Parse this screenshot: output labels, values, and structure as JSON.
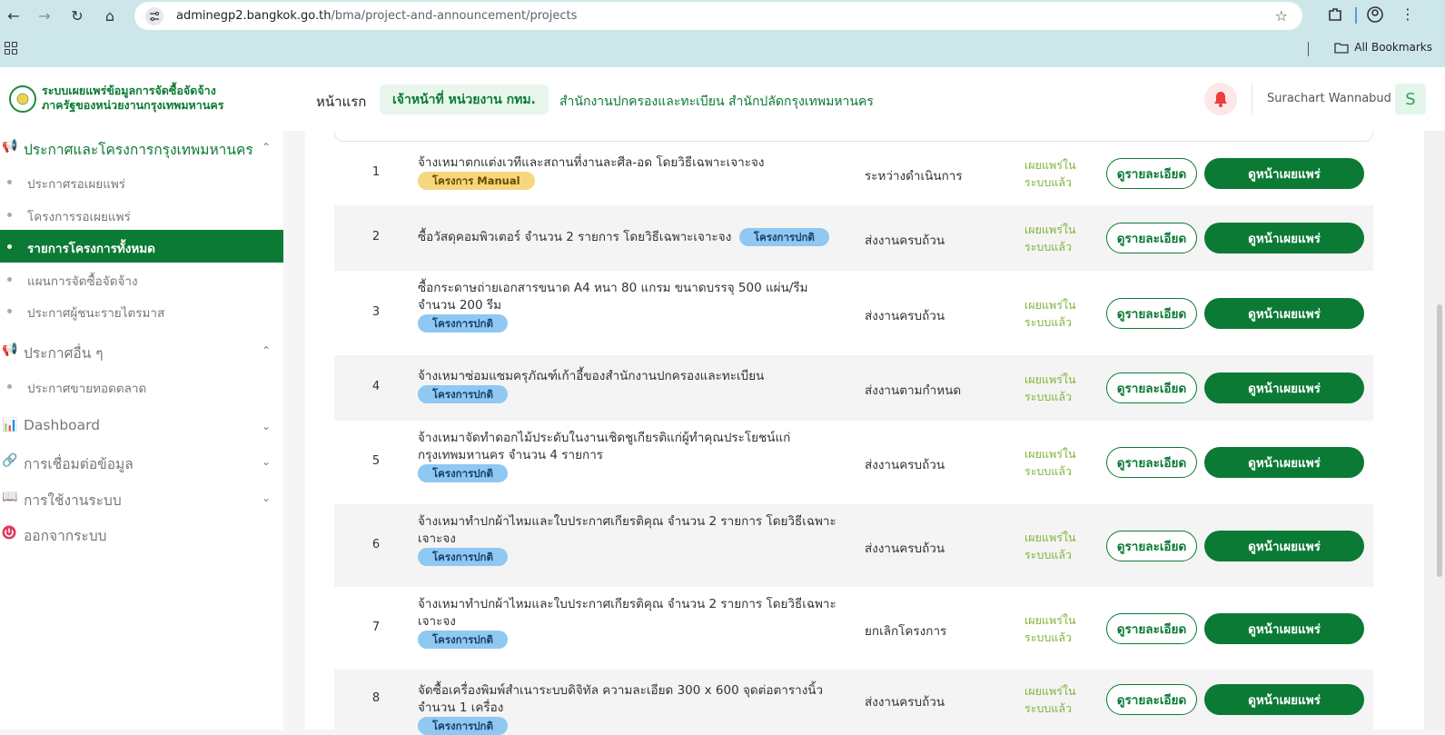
{
  "browser": {
    "url_host": "adminegp2.bangkok.go.th",
    "url_path": "/bma/project-and-announcement/projects",
    "bookmarks_label": "All Bookmarks"
  },
  "header": {
    "brand_line1": "ระบบเผยแพร่ข้อมูลการจัดซื้อจัดจ้าง",
    "brand_line2": "ภาครัฐของหน่วยงานกรุงเทพมหานคร",
    "nav_home": "หน้าแรก",
    "nav_pill": "เจ้าหน้าที่ หน่วยงาน กทม.",
    "nav_org": "สำนักงานปกครองและทะเบียน สำนักปลัดกรุงเทพมหานคร",
    "user_name": "Surachart Wannabud",
    "avatar_letter": "S"
  },
  "sidebar": {
    "section1": "ประกาศและโครงการกรุงเทพมหานคร",
    "section1_items": [
      "ประกาศรอเผยแพร่",
      "โครงการรอเผยแพร่",
      "รายการโครงการทั้งหมด",
      "แผนการจัดซื้อจัดจ้าง",
      "ประกาศผู้ชนะรายไตรมาส"
    ],
    "section2": "ประกาศอื่น ๆ",
    "section2_items": [
      "ประกาศขายทอดตลาด"
    ],
    "dashboard": "Dashboard",
    "data_link": "การเชื่อมต่อข้อมูล",
    "usage": "การใช้งานระบบ",
    "logout": "ออกจากระบบ"
  },
  "buttons": {
    "detail": "ดูรายละเอียด",
    "view": "ดูหน้าเผยแพร่"
  },
  "rows": [
    {
      "num": "1",
      "title": "จ้างเหมาตกแต่งเวทีและสถานที่งานละศีล-อด โดยวิธีเฉพาะเจาะจง",
      "tag": "โครงการ Manual",
      "status": "ระหว่างดำเนินการ",
      "pub1": "เผยแพร่ใน",
      "pub2": "ระบบแล้ว"
    },
    {
      "num": "2",
      "title": "ซื้อวัสดุคอมพิวเตอร์ จำนวน 2 รายการ โดยวิธีเฉพาะเจาะจง",
      "tag": "โครงการปกติ",
      "status": "ส่งงานครบถ้วน",
      "pub1": "เผยแพร่ใน",
      "pub2": "ระบบแล้ว"
    },
    {
      "num": "3",
      "title": "ซื้อกระดาษถ่ายเอกสารขนาด A4 หนา 80 แกรม ขนาดบรรจุ 500 แผ่น/รีม จำนวน 200 รีม",
      "tag": "โครงการปกติ",
      "status": "ส่งงานครบถ้วน",
      "pub1": "เผยแพร่ใน",
      "pub2": "ระบบแล้ว"
    },
    {
      "num": "4",
      "title": "จ้างเหมาซ่อมแซมครุภัณฑ์เก้าอี้ของสำนักงานปกครองและทะเบียน",
      "tag": "โครงการปกติ",
      "status": "ส่งงานตามกำหนด",
      "pub1": "เผยแพร่ใน",
      "pub2": "ระบบแล้ว"
    },
    {
      "num": "5",
      "title": "จ้างเหมาจัดทำดอกไม้ประดับในงานเชิดชูเกียรติแก่ผู้ทำคุณประโยชน์แก่กรุงเทพมหานคร จำนวน 4 รายการ",
      "tag": "โครงการปกติ",
      "status": "ส่งงานครบถ้วน",
      "pub1": "เผยแพร่ใน",
      "pub2": "ระบบแล้ว"
    },
    {
      "num": "6",
      "title": "จ้างเหมาทำปกผ้าไหมและใบประกาศเกียรติคุณ จำนวน 2 รายการ โดยวิธีเฉพาะเจาะจง",
      "tag": "โครงการปกติ",
      "status": "ส่งงานครบถ้วน",
      "pub1": "เผยแพร่ใน",
      "pub2": "ระบบแล้ว"
    },
    {
      "num": "7",
      "title": "จ้างเหมาทำปกผ้าไหมและใบประกาศเกียรติคุณ จำนวน 2 รายการ โดยวิธีเฉพาะเจาะจง",
      "tag": "โครงการปกติ",
      "status": "ยกเลิกโครงการ",
      "pub1": "เผยแพร่ใน",
      "pub2": "ระบบแล้ว"
    },
    {
      "num": "8",
      "title": "จัดซื้อเครื่องพิมพ์สำเนาระบบดิจิทัล ความละเอียด 300 x 600 จุดต่อตารางนิ้ว จำนวน 1 เครื่อง",
      "tag": "โครงการปกติ",
      "status": "ส่งงานครบถ้วน",
      "pub1": "เผยแพร่ใน",
      "pub2": "ระบบแล้ว"
    }
  ]
}
